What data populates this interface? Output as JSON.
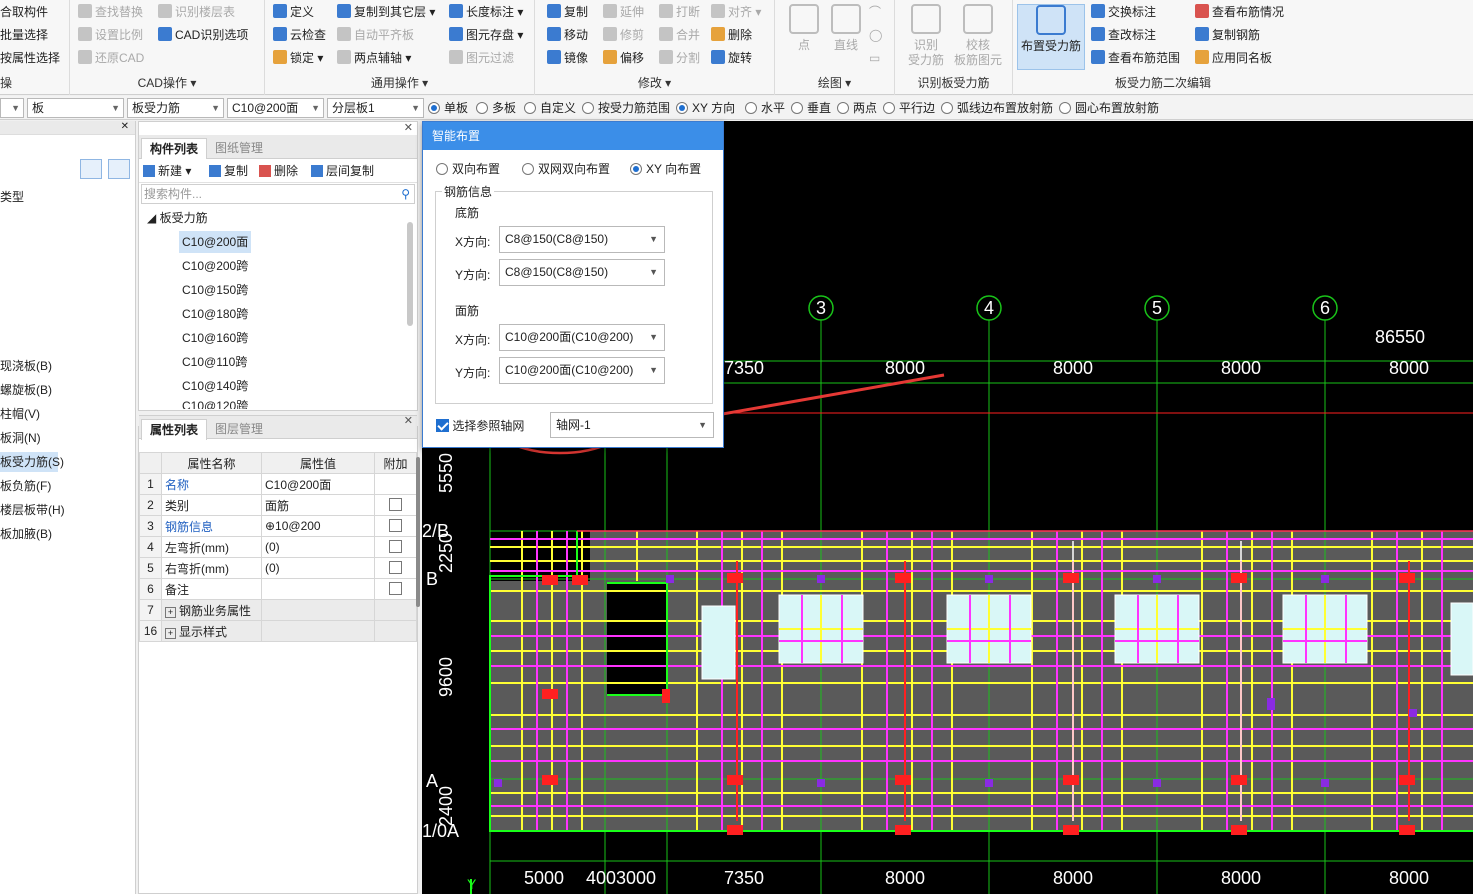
{
  "ribbon": {
    "left_partial": {
      "items": [
        "合取构件",
        "批量选择",
        "按属性选择",
        "操"
      ]
    },
    "cad_group": {
      "title": "CAD操作",
      "items": [
        "查找替换",
        "识别楼层表",
        "设置比例",
        "CAD识别选项",
        "还原CAD"
      ]
    },
    "general_group": {
      "title": "通用操作",
      "items": [
        "定义",
        "复制到其它层",
        "长度标注",
        "云检查",
        "自动平齐板",
        "图元存盘",
        "锁定",
        "两点辅轴",
        "图元过滤"
      ]
    },
    "modify_group": {
      "title": "修改",
      "items": [
        "复制",
        "延伸",
        "打断",
        "对齐",
        "移动",
        "修剪",
        "合并",
        "删除",
        "镜像",
        "偏移",
        "分割",
        "旋转"
      ]
    },
    "draw_group": {
      "title": "绘图",
      "items": [
        "点",
        "直线"
      ]
    },
    "identify_group": {
      "title": "识别板受力筋",
      "items": [
        "识别\n受力筋",
        "校核\n板筋图元"
      ]
    },
    "edit_group": {
      "title": "板受力筋二次编辑",
      "active_button": "布置受力筋",
      "items": [
        "交换标注",
        "查看布筋情况",
        "查改标注",
        "复制钢筋",
        "查看布筋范围",
        "应用同名板"
      ]
    }
  },
  "selector_row": {
    "combos": [
      "",
      "板",
      "板受力筋",
      "C10@200面",
      "分层板1"
    ],
    "radios": [
      {
        "label": "单板",
        "checked": true
      },
      {
        "label": "多板",
        "checked": false
      },
      {
        "label": "自定义",
        "checked": false
      },
      {
        "label": "按受力筋范围",
        "checked": false
      },
      {
        "label": "XY 方向",
        "checked": true
      },
      {
        "label": "水平",
        "checked": false
      },
      {
        "label": "垂直",
        "checked": false
      },
      {
        "label": "两点",
        "checked": false
      },
      {
        "label": "平行边",
        "checked": false
      },
      {
        "label": "弧线边布置放射筋",
        "checked": false
      },
      {
        "label": "圆心布置放射筋",
        "checked": false
      }
    ]
  },
  "left_nav": {
    "items": [
      "类型",
      "现浇板(B)",
      "螺旋板(B)",
      "柱帽(V)",
      "板洞(N)",
      "板受力筋(S)",
      "板负筋(F)",
      "楼层板带(H)",
      "板加腋(B)"
    ],
    "selected_index": 5
  },
  "component_list": {
    "tabs": [
      "构件列表",
      "图纸管理"
    ],
    "toolbar": [
      "新建",
      "复制",
      "删除",
      "层间复制"
    ],
    "search_placeholder": "搜索构件...",
    "root": "板受力筋",
    "items": [
      "C10@200面",
      "C10@200跨",
      "C10@150跨",
      "C10@180跨",
      "C10@160跨",
      "C10@110跨",
      "C10@140跨",
      "C10@120跨"
    ],
    "selected_index": 0
  },
  "properties": {
    "tabs": [
      "属性列表",
      "图层管理"
    ],
    "headers": [
      "属性名称",
      "属性值",
      "附加"
    ],
    "rows": [
      {
        "num": "1",
        "name": "名称",
        "value": "C10@200面",
        "blue": true,
        "check": false
      },
      {
        "num": "2",
        "name": "类别",
        "value": "面筋",
        "blue": false,
        "check": true
      },
      {
        "num": "3",
        "name": "钢筋信息",
        "value": "⊕10@200",
        "blue": true,
        "check": true
      },
      {
        "num": "4",
        "name": "左弯折(mm)",
        "value": "(0)",
        "blue": false,
        "check": true
      },
      {
        "num": "5",
        "name": "右弯折(mm)",
        "value": "(0)",
        "blue": false,
        "check": true
      },
      {
        "num": "6",
        "name": "备注",
        "value": "",
        "blue": false,
        "check": true
      },
      {
        "num": "7",
        "name": "钢筋业务属性",
        "value": "",
        "blue": false,
        "check": false,
        "expand": true
      },
      {
        "num": "16",
        "name": "显示样式",
        "value": "",
        "blue": false,
        "check": false,
        "expand": true
      }
    ]
  },
  "dialog": {
    "title": "智能布置",
    "modes": [
      {
        "label": "双向布置",
        "checked": false
      },
      {
        "label": "双网双向布置",
        "checked": false
      },
      {
        "label": "XY 向布置",
        "checked": true
      }
    ],
    "group_title": "钢筋信息",
    "bottom_title": "底筋",
    "bottom_x_label": "X方向:",
    "bottom_x_value": "C8@150(C8@150)",
    "bottom_y_label": "Y方向:",
    "bottom_y_value": "C8@150(C8@150)",
    "top_title": "面筋",
    "top_x_label": "X方向:",
    "top_x_value": "C10@200面(C10@200)",
    "top_y_label": "Y方向:",
    "top_y_value": "C10@200面(C10@200)",
    "axis_checkbox_label": "选择参照轴网",
    "axis_value": "轴网-1"
  },
  "drawing": {
    "axis_bubbles": [
      "3",
      "4",
      "5",
      "6"
    ],
    "total_dimension": "86550",
    "top_dimensions": [
      "7350",
      "8000",
      "8000",
      "8000",
      "8000"
    ],
    "bottom_dimensions": [
      "5000",
      "4003000",
      "7350",
      "8000",
      "8000",
      "8000",
      "8000"
    ],
    "left_dimensions": [
      "5550",
      "2250",
      "9600",
      "2400"
    ],
    "row_labels": [
      "2/B",
      "B",
      "A",
      "1/0A"
    ],
    "ucs_label": "Y",
    "colors": {
      "background": "#000000",
      "slab": "#5a5a5a",
      "grid": "#19c219",
      "rebar_yellow": "#ffff33",
      "rebar_magenta": "#ff33ff",
      "beam_red": "#ff2020",
      "annotation": "#e53935"
    }
  }
}
